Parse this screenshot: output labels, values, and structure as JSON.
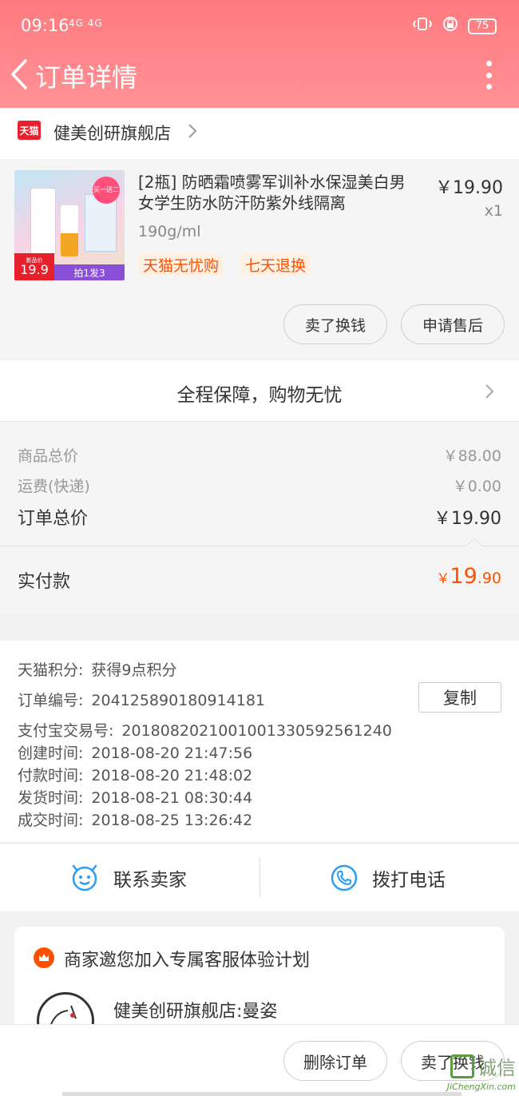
{
  "status_bar": {
    "time": "09:16",
    "signal": "4G 4G",
    "battery": "75"
  },
  "header": {
    "title": "订单详情"
  },
  "store": {
    "logo_text": "天猫",
    "name": "健美创研旗舰店"
  },
  "product": {
    "title": "[2瓶] 防晒霜喷雾军训补水保湿美白男女学生防水防汗防紫外线隔离",
    "spec": "190g/ml",
    "price": "￥19.90",
    "quantity": "x1",
    "tags": [
      "天猫无忧购",
      "七天退换"
    ],
    "image": {
      "badge": "买一送二",
      "price_label": "新品价",
      "price": "19.9",
      "promo": "拍1发3"
    },
    "buttons": {
      "sell": "卖了换钱",
      "after_sale": "申请售后"
    }
  },
  "guarantee": {
    "text": "全程保障，购物无忧"
  },
  "summary": {
    "goods_total_label": "商品总价",
    "goods_total_value": "￥88.00",
    "shipping_label": "运费(快递)",
    "shipping_value": "￥0.00",
    "order_total_label": "订单总价",
    "order_total_value": "￥19.90",
    "paid_label": "实付款",
    "paid_currency": "￥",
    "paid_integer": "19",
    "paid_decimal": ".90"
  },
  "order_info": {
    "points_label": "天猫积分:",
    "points_value": "获得9点积分",
    "order_no_label": "订单编号:",
    "order_no_value": "204125890180914181",
    "copy_button": "复制",
    "alipay_label": "支付宝交易号:",
    "alipay_value": "2018082021001001330592561240",
    "created_label": "创建时间:",
    "created_value": "2018-08-20 21:47:56",
    "paid_time_label": "付款时间:",
    "paid_time_value": "2018-08-20 21:48:02",
    "shipped_label": "发货时间:",
    "shipped_value": "2018-08-21 08:30:44",
    "completed_label": "成交时间:",
    "completed_value": "2018-08-25 13:26:42"
  },
  "contact": {
    "seller": "联系卖家",
    "phone": "拨打电话"
  },
  "service_plan": {
    "title": "商家邀您加入专属客服体验计划",
    "store_agent": "健美创研旗舰店:曼姿"
  },
  "bottom_bar": {
    "delete_order": "删除订单",
    "sell": "卖了换钱"
  },
  "watermark": {
    "text": "诚信",
    "url": "JiChengXin.com"
  },
  "colors": {
    "header": "#ff7a7e",
    "accent": "#ff5000",
    "tmall_red": "#e8202c",
    "contact_blue": "#2a9df4"
  }
}
